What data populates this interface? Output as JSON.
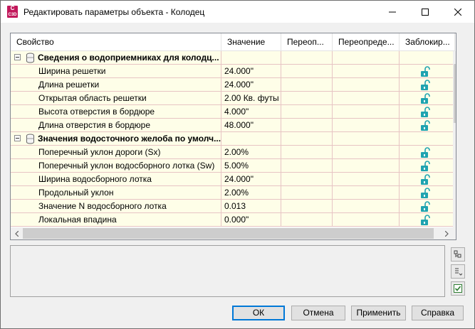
{
  "window": {
    "title": "Редактировать параметры объекта - Колодец",
    "app_icon_text": "C",
    "app_icon_sub": "C3D"
  },
  "grid": {
    "columns": [
      "Свойство",
      "Значение",
      "Переоп...",
      "Переопреде...",
      "Заблокир..."
    ],
    "rows": [
      {
        "type": "category",
        "label": "Сведения о водоприемниках для колодц...",
        "value": "",
        "locked": false
      },
      {
        "type": "property",
        "label": "Ширина решетки",
        "value": "24.000\"",
        "locked": true
      },
      {
        "type": "property",
        "label": "Длина решетки",
        "value": "24.000\"",
        "locked": true
      },
      {
        "type": "property",
        "label": "Открытая область решетки",
        "value": "2.00 Кв. футы",
        "locked": true
      },
      {
        "type": "property",
        "label": "Высота отверстия в бордюре",
        "value": "4.000\"",
        "locked": true
      },
      {
        "type": "property",
        "label": "Длина отверстия в бордюре",
        "value": "48.000\"",
        "locked": true
      },
      {
        "type": "category",
        "label": "Значения водосточного желоба по умолч...",
        "value": "",
        "locked": false
      },
      {
        "type": "property",
        "label": "Поперечный уклон дороги (Sx)",
        "value": "2.00%",
        "locked": true
      },
      {
        "type": "property",
        "label": "Поперечный уклон водосборного лотка (Sw)",
        "value": "5.00%",
        "locked": true
      },
      {
        "type": "property",
        "label": "Ширина водосборного лотка",
        "value": "24.000\"",
        "locked": true
      },
      {
        "type": "property",
        "label": "Продольный уклон",
        "value": "2.00%",
        "locked": true
      },
      {
        "type": "property",
        "label": "Значение N водосборного лотка",
        "value": "0.013",
        "locked": true
      },
      {
        "type": "property",
        "label": "Локальная впадина",
        "value": "0.000\"",
        "locked": true
      }
    ]
  },
  "buttons": {
    "ok": "ОК",
    "cancel": "Отмена",
    "apply": "Применить",
    "help": "Справка"
  },
  "colors": {
    "grid_row_bg": "#fefee8",
    "grid_line": "#e7c4c4",
    "lock_icon": "#1fa3b0",
    "default_button_border": "#0078d7"
  }
}
